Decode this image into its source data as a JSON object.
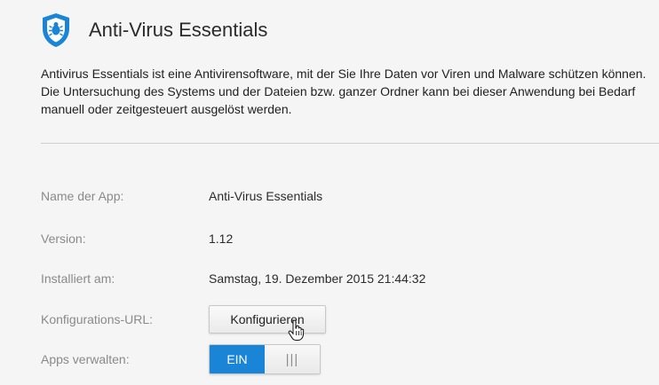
{
  "app": {
    "title": "Anti-Virus Essentials",
    "description": "Antivirus Essentials ist eine Antivirensoftware, mit der Sie Ihre Daten vor Viren und Malware schützen können. Die Untersuchung des Systems und der Dateien bzw. ganzer Ordner kann bei dieser Anwendung bei Bedarf manuell oder zeitgesteuert ausgelöst werden.",
    "icon": "shield-bug-icon"
  },
  "details": {
    "name_label": "Name der App:",
    "name_value": "Anti-Virus Essentials",
    "version_label": "Version:",
    "version_value": "1.12",
    "installed_label": "Installiert am:",
    "installed_value": "Samstag, 19. Dezember 2015 21:44:32",
    "config_label": "Konfigurations-URL:",
    "config_button": "Konfigurieren",
    "manage_label": "Apps verwalten:",
    "toggle_on": "EIN",
    "toggle_off": "|||"
  },
  "colors": {
    "accent": "#1a85d6",
    "background": "#f5f5f5"
  }
}
